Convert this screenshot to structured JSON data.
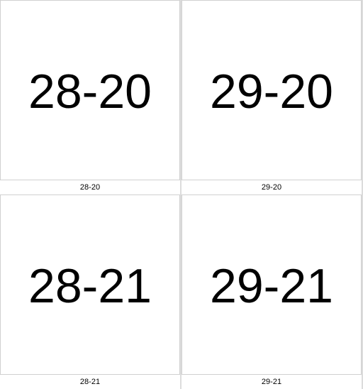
{
  "tiles": [
    {
      "label": "28-20",
      "caption": "28-20"
    },
    {
      "label": "29-20",
      "caption": "29-20"
    },
    {
      "label": "28-21",
      "caption": "28-21"
    },
    {
      "label": "29-21",
      "caption": "29-21"
    }
  ],
  "colors": {
    "background": "#dcdcdc",
    "tile": "#ffffff",
    "text": "#000000"
  }
}
